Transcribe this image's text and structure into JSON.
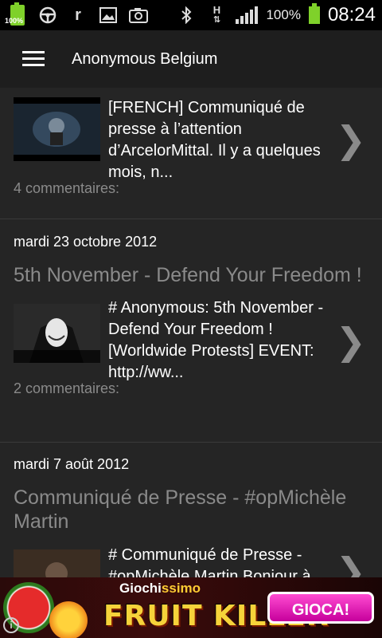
{
  "status_bar": {
    "battery_small_label": "100%",
    "battery_percent": "100%",
    "time": "08:24",
    "icons": [
      "battery-icon",
      "steering-wheel-icon",
      "r-icon",
      "image-icon",
      "camera-icon",
      "bluetooth-icon",
      "h-signal-icon",
      "signal-icon",
      "battery-icon"
    ]
  },
  "app_bar": {
    "title": "Anonymous Belgium"
  },
  "posts": [
    {
      "date": "",
      "title": "",
      "excerpt": "[FRENCH] Communiqué de presse à l’attention d’ArcelorMittal. Il y a quelques mois, n...",
      "comments": "4 commentaires:"
    },
    {
      "date": "mardi 23 octobre 2012",
      "title": "5th November - Defend Your Freedom !",
      "excerpt": "# Anonymous: 5th November - Defend Your Freedom ! [Worldwide Protests] EVENT: http://ww...",
      "comments": "2 commentaires:"
    },
    {
      "date": "mardi 7 août 2012",
      "title": "Communiqué de Presse - #opMichèle Martin",
      "excerpt": "# Communiqué de Presse - #opMichèle Martin Bonjour à",
      "comments": ""
    }
  ],
  "chevron_glyph": "❯",
  "ad": {
    "brand_a": "Giochi",
    "brand_b": "ssimo",
    "game": "FRUIT KILLER",
    "button": "GIOCA!",
    "info": "i"
  },
  "colors": {
    "background": "#232323",
    "accent_green": "#7fd12a",
    "muted_text": "#8a8a8a",
    "ad_button": "#e020b0"
  }
}
